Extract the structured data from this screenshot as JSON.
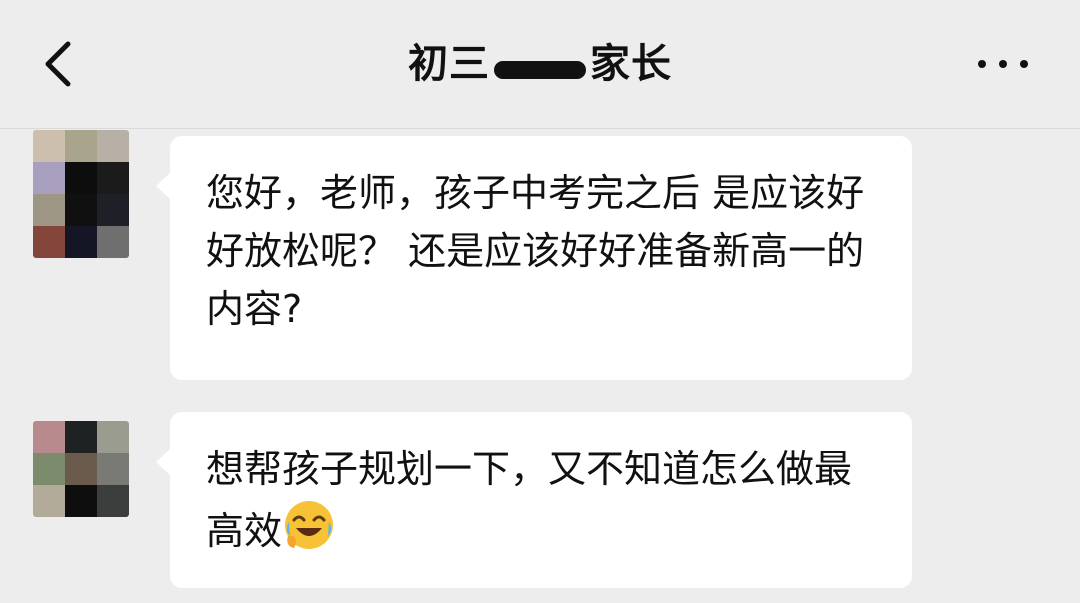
{
  "header": {
    "title_prefix": "初三",
    "title_suffix": "家长",
    "back_icon": "chevron-left-icon",
    "more_icon": "more-dots-icon"
  },
  "messages": [
    {
      "text": "您好，老师，孩子中考完之后 是应该好好放松呢？ 还是应该好好准备新高一的内容?",
      "avatar_colors": [
        "#cdbfae",
        "#a8a58c",
        "#b8b0a6",
        "#a79fbd",
        "#0d0d0d",
        "#1b1b1b",
        "#9d9685",
        "#101010",
        "#1e1f27",
        "#84463a",
        "#141525",
        "#6f6f6f"
      ]
    },
    {
      "text": "想帮孩子规划一下，又不知道怎么做最高效",
      "emoji": "laughing-crying-face-emoji",
      "avatar_colors": [
        "#b8898d",
        "#1e2222",
        "#9b9c90",
        "#7c8b6c",
        "#6b5b4c",
        "#7a7a75",
        "#b3ab9a",
        "#0e0e0e",
        "#3c3d3d"
      ]
    }
  ],
  "colors": {
    "background": "#ededed",
    "bubble": "#ffffff",
    "text": "#111111"
  }
}
